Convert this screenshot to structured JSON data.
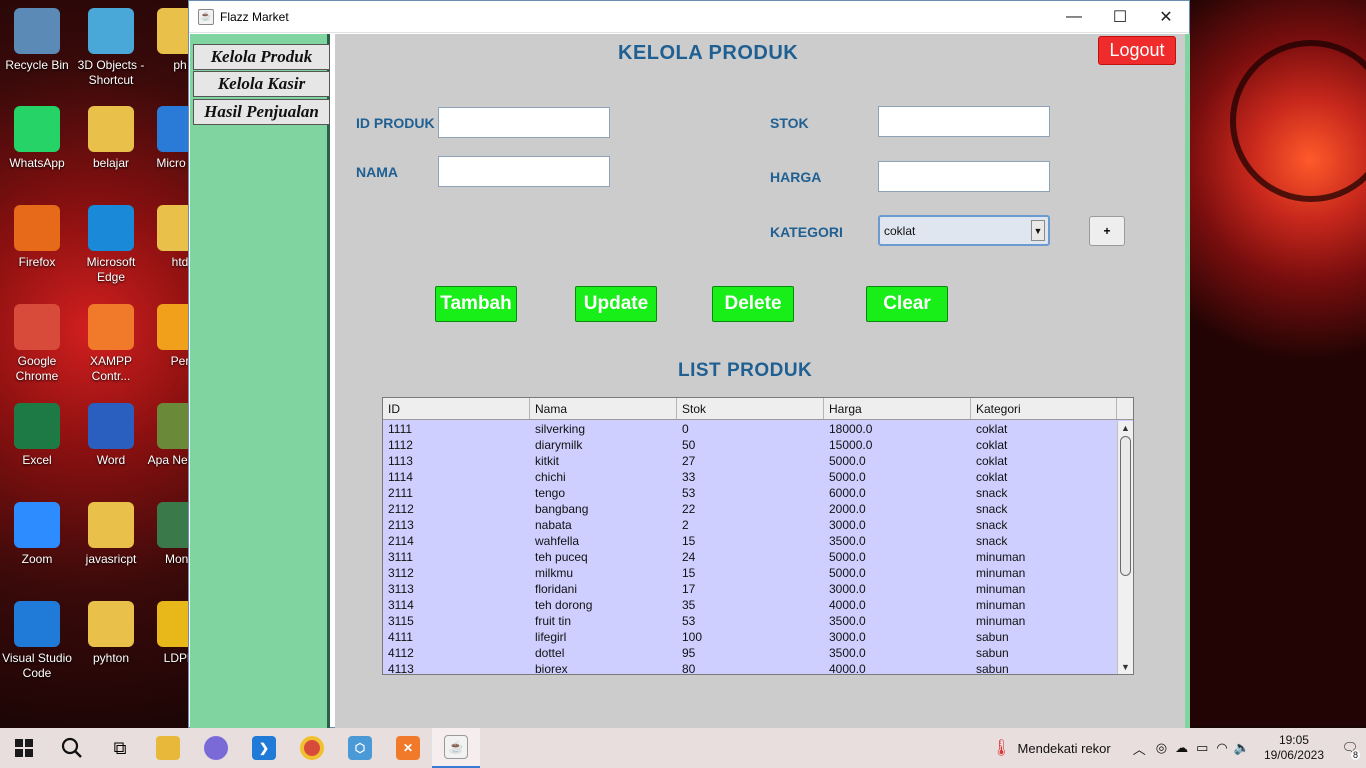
{
  "desktop": {
    "icons": [
      {
        "label": "Recycle Bin",
        "color": "#5a8ab5"
      },
      {
        "label": "3D Objects - Shortcut",
        "color": "#4aa8d8"
      },
      {
        "label": "ph",
        "color": "#e8c04a"
      },
      {
        "label": "WhatsApp",
        "color": "#25d366"
      },
      {
        "label": "belajar",
        "color": "#e8c04a"
      },
      {
        "label": "Micro Ed",
        "color": "#2a7ad8"
      },
      {
        "label": "Firefox",
        "color": "#e66a1a"
      },
      {
        "label": "Microsoft Edge",
        "color": "#1a8ad8"
      },
      {
        "label": "htd",
        "color": "#e8c04a"
      },
      {
        "label": "Google Chrome",
        "color": "#d84a3a"
      },
      {
        "label": "XAMPP Contr...",
        "color": "#f07a2a"
      },
      {
        "label": "Per",
        "color": "#f0a01a"
      },
      {
        "label": "Excel",
        "color": "#1d7a44"
      },
      {
        "label": "Word",
        "color": "#2b5fbf"
      },
      {
        "label": "Apa NetBea",
        "color": "#6a8a3a"
      },
      {
        "label": "Zoom",
        "color": "#2d8cff"
      },
      {
        "label": "javasricpt",
        "color": "#e8c04a"
      },
      {
        "label": "Mong",
        "color": "#3a7a4a"
      },
      {
        "label": "Visual Studio Code",
        "color": "#1f7ad8"
      },
      {
        "label": "pyhton",
        "color": "#e8c04a"
      },
      {
        "label": "LDPla",
        "color": "#e8b81a"
      }
    ]
  },
  "window": {
    "title": "Flazz Market",
    "minimize": "—",
    "maximize": "☐",
    "close": "✕"
  },
  "sidebar": {
    "items": [
      {
        "label": "Kelola Produk"
      },
      {
        "label": "Kelola Kasir"
      },
      {
        "label": "Hasil Penjualan"
      }
    ]
  },
  "main": {
    "title": "KELOLA PRODUK",
    "logout": "Logout",
    "labels": {
      "id_produk": "ID PRODUK",
      "nama": "NAMA",
      "stok": "STOK",
      "harga": "HARGA",
      "kategori": "KATEGORI"
    },
    "fields": {
      "id_produk": "",
      "nama": "",
      "stok": "",
      "harga": ""
    },
    "kategori_selected": "coklat",
    "plus": "+",
    "buttons": {
      "tambah": "Tambah",
      "update": "Update",
      "delete": "Delete",
      "clear": "Clear"
    },
    "list_title": "LIST PRODUK"
  },
  "table": {
    "columns": [
      "ID",
      "Nama",
      "Stok",
      "Harga",
      "Kategori"
    ],
    "rows": [
      [
        "1111",
        "silverking",
        "0",
        "18000.0",
        "coklat"
      ],
      [
        "1112",
        "diarymilk",
        "50",
        "15000.0",
        "coklat"
      ],
      [
        "1113",
        "kitkit",
        "27",
        "5000.0",
        "coklat"
      ],
      [
        "1114",
        "chichi",
        "33",
        "5000.0",
        "coklat"
      ],
      [
        "2111",
        "tengo",
        "53",
        "6000.0",
        "snack"
      ],
      [
        "2112",
        "bangbang",
        "22",
        "2000.0",
        "snack"
      ],
      [
        "2113",
        "nabata",
        "2",
        "3000.0",
        "snack"
      ],
      [
        "2114",
        "wahfella",
        "15",
        "3500.0",
        "snack"
      ],
      [
        "3111",
        "teh puceq",
        "24",
        "5000.0",
        "minuman"
      ],
      [
        "3112",
        "milkmu",
        "15",
        "5000.0",
        "minuman"
      ],
      [
        "3113",
        "floridani",
        "17",
        "3000.0",
        "minuman"
      ],
      [
        "3114",
        "teh dorong",
        "35",
        "4000.0",
        "minuman"
      ],
      [
        "3115",
        "fruit tin",
        "53",
        "3500.0",
        "minuman"
      ],
      [
        "4111",
        "lifegirl",
        "100",
        "3000.0",
        "sabun"
      ],
      [
        "4112",
        "dottel",
        "95",
        "3500.0",
        "sabun"
      ],
      [
        "4113",
        "biorex",
        "80",
        "4000.0",
        "sabun"
      ]
    ]
  },
  "taskbar": {
    "weather": "Mendekati rekor",
    "time": "19:05",
    "date": "19/06/2023",
    "notifications": "8"
  }
}
